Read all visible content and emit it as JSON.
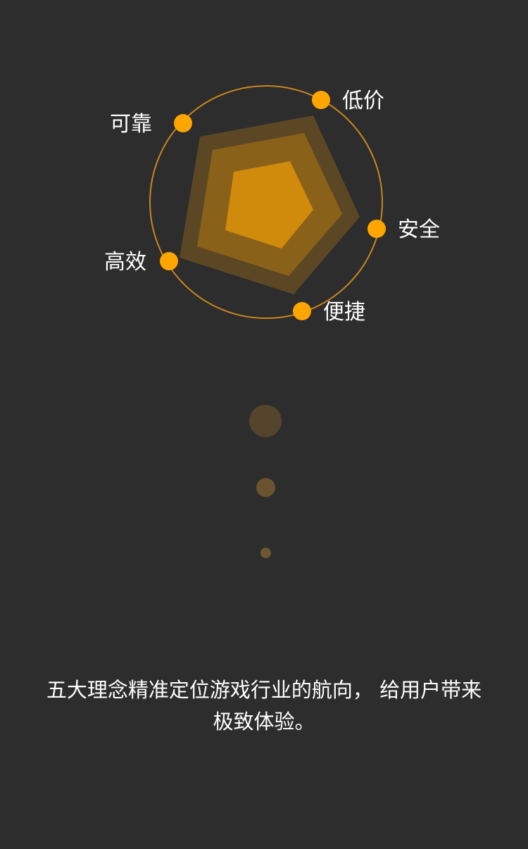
{
  "radar": {
    "labels": {
      "low_price": "低价",
      "safe": "安全",
      "convenient": "便捷",
      "efficient": "高效",
      "reliable": "可靠"
    },
    "colors": {
      "ring": "#c8861e",
      "marker": "#ffa500",
      "outer_shape": "#5c4725",
      "middle_shape": "#8a6119",
      "inner_shape": "#d08a0c"
    }
  },
  "tagline": "五大理念精准定位游戏行业的航向， 给用户带来极致体验。"
}
